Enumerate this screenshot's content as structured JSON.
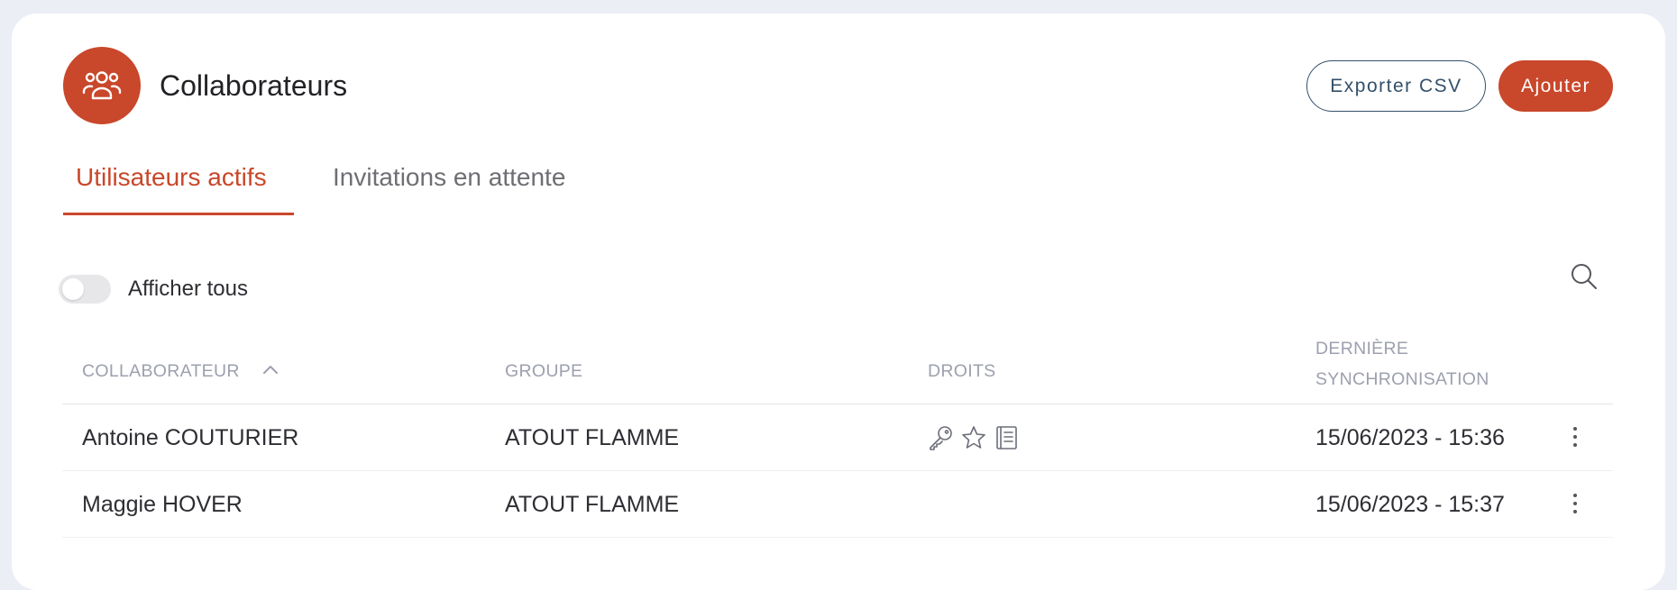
{
  "header": {
    "title": "Collaborateurs",
    "icon": "users-group-icon",
    "accent": "#c9472a",
    "export_label": "Exporter CSV",
    "add_label": "Ajouter"
  },
  "tabs": [
    {
      "label": "Utilisateurs actifs",
      "active": true
    },
    {
      "label": "Invitations en attente",
      "active": false
    }
  ],
  "filter": {
    "toggle_label": "Afficher tous",
    "toggle_on": false
  },
  "table": {
    "columns": {
      "collaborator": "COLLABORATEUR",
      "group": "GROUPE",
      "rights": "DROITS",
      "last_sync_line1": "DERNIÈRE",
      "last_sync_line2": "SYNCHRONISATION"
    },
    "sort": {
      "column": "collaborator",
      "direction": "asc"
    },
    "rows": [
      {
        "name": "Antoine COUTURIER",
        "group": "ATOUT FLAMME",
        "rights": [
          "key-icon",
          "star-icon",
          "book-icon"
        ],
        "last_sync": "15/06/2023 - 15:36"
      },
      {
        "name": "Maggie HOVER",
        "group": "ATOUT FLAMME",
        "rights": [],
        "last_sync": "15/06/2023 - 15:37"
      }
    ]
  }
}
